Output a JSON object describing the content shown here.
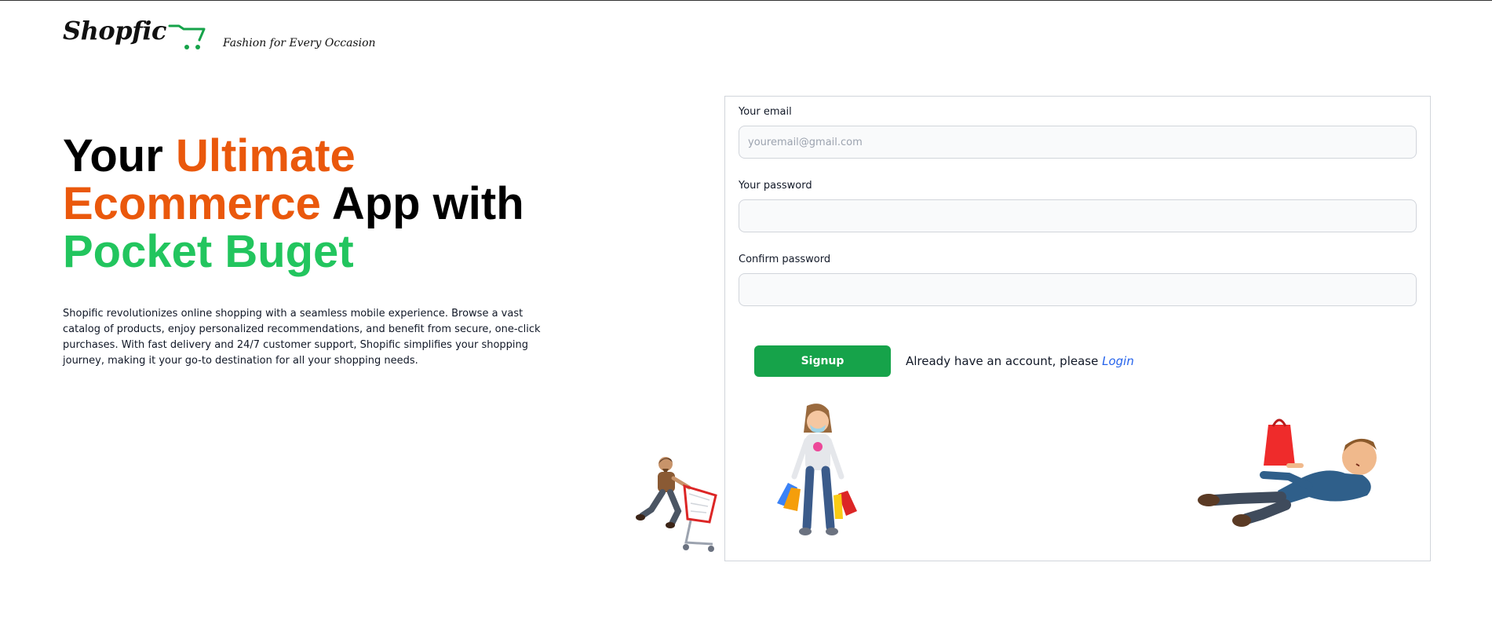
{
  "brand": {
    "logo_text": "Shopfic",
    "tagline": "Fashion for Every Occasion",
    "icon": "shopping-cart-icon"
  },
  "hero": {
    "title": {
      "part1": "Your ",
      "part2": "Ultimate",
      "part3": "Ecommerce",
      "part4": " App with",
      "part5": "Pocket Buget"
    },
    "description": "Shopific revolutionizes online shopping with a seamless mobile experience. Browse a vast catalog of products, enjoy personalized recommendations, and benefit from secure, one-click purchases. With fast delivery and 24/7 customer support, Shopific simplifies your shopping journey, making it your go-to destination for all your shopping needs."
  },
  "form": {
    "email": {
      "label": "Your email",
      "placeholder": "youremail@gmail.com",
      "value": ""
    },
    "password": {
      "label": "Your password",
      "placeholder": "",
      "value": ""
    },
    "confirm_password": {
      "label": "Confirm password",
      "placeholder": "",
      "value": ""
    },
    "signup_label": "Signup",
    "login_prompt": "Already have an account, please ",
    "login_label": "Login"
  },
  "colors": {
    "accent_orange": "#ea580c",
    "accent_green": "#22c55e",
    "button_green": "#16a34a",
    "link_blue": "#2563eb"
  },
  "illustrations": [
    "man-pushing-cart-illustration",
    "girl-with-shopping-bags-illustration",
    "man-lying-with-bag-illustration"
  ]
}
